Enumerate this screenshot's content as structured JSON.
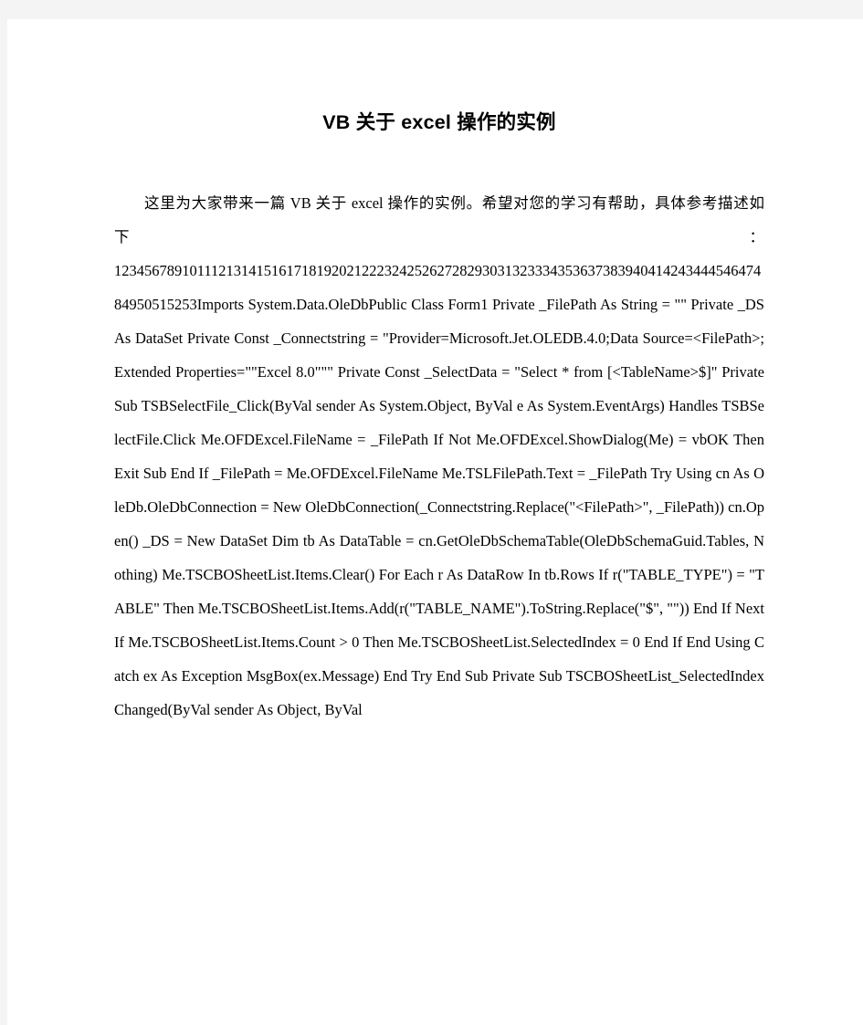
{
  "document": {
    "title": "VB 关于 excel 操作的实例",
    "background_color": "#f4f4f4",
    "page_color": "#ffffff",
    "text_color": "#000000",
    "intro_paragraph": "这里为大家带来一篇 VB 关于 excel 操作的实例。希望对您的学习有帮助，具体参考描述如下：",
    "line_numbers": "1234567891011121314151617181920212223242526272829303132333435363738394041424344454647484950515253",
    "code_body": "Imports System.Data.OleDbPublic Class Form1    Private _FilePath As String = \"\"    Private _DS As DataSet    Private Const _Connectstring = \"Provider=Microsoft.Jet.OLEDB.4.0;Data Source=<FilePath>;Extended Properties=\"\"Excel 8.0\"\"\"    Private Const _SelectData = \"Select * from [<TableName>$]\"    Private Sub TSBSelectFile_Click(ByVal sender As System.Object, ByVal e As System.EventArgs) Handles TSBSelectFile.Click        Me.OFDExcel.FileName = _FilePath        If Not Me.OFDExcel.ShowDialog(Me) = vbOK Then            Exit Sub        End If        _FilePath = Me.OFDExcel.FileName        Me.TSLFilePath.Text = _FilePath        Try            Using cn As OleDb.OleDbConnection = New OleDbConnection(_Connectstring.Replace(\"<FilePath>\", _FilePath))                cn.Open()                _DS = New DataSet                Dim tb As DataTable = cn.GetOleDbSchemaTable(OleDbSchemaGuid.Tables, Nothing)                Me.TSCBOSheetList.Items.Clear()                For Each r As DataRow In tb.Rows                    If r(\"TABLE_TYPE\") = \"TABLE\" Then                        Me.TSCBOSheetList.Items.Add(r(\"TABLE_NAME\").ToString.Replace(\"$\", \"\"))                    End If                Next                If Me.TSCBOSheetList.Items.Count > 0 Then                    Me.TSCBOSheetList.SelectedIndex = 0                End If            End Using        Catch ex As Exception            MsgBox(ex.Message)        End Try    End Sub    Private Sub TSCBOSheetList_SelectedIndexChanged(ByVal sender As Object, ByVal"
  }
}
